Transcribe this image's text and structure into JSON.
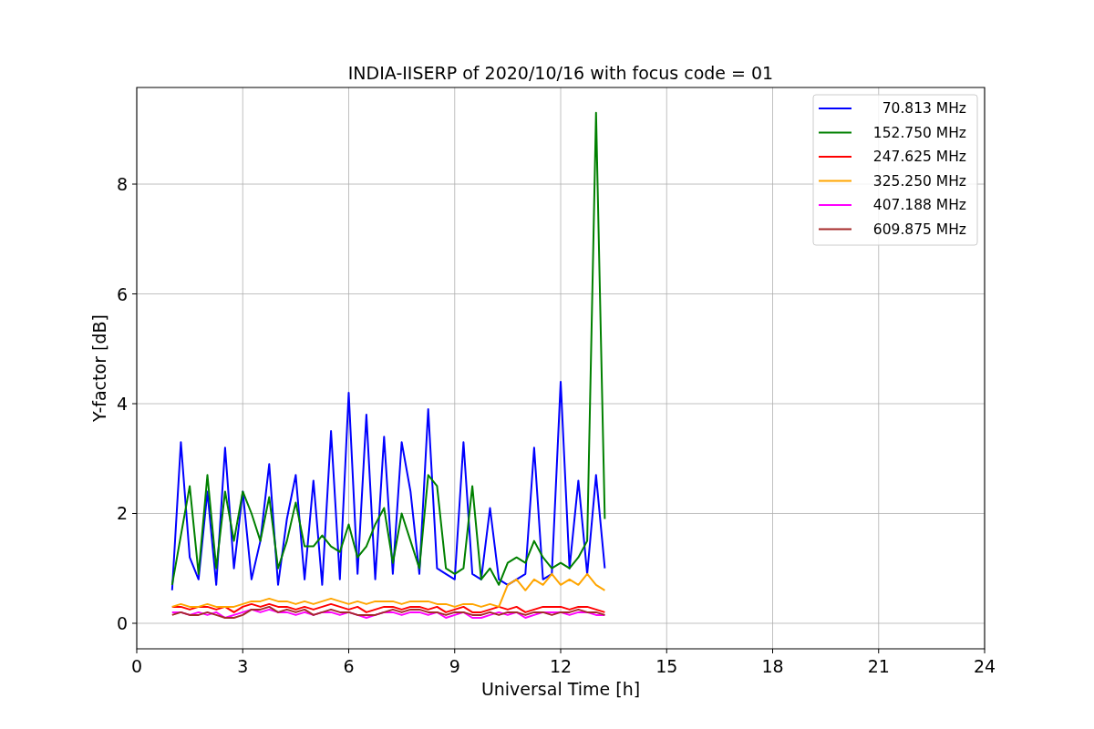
{
  "chart": {
    "chart_data": {
      "type": "line",
      "title": "INDIA-IISERP of 2020/10/16 with focus code = 01",
      "xlabel": "Universal Time [h]",
      "ylabel": "Y-factor [dB]",
      "x": [
        1,
        1.25,
        1.5,
        1.75,
        2,
        2.25,
        2.5,
        2.75,
        3,
        3.25,
        3.5,
        3.75,
        4,
        4.25,
        4.5,
        4.75,
        5,
        5.25,
        5.5,
        5.75,
        6,
        6.25,
        6.5,
        6.75,
        7,
        7.25,
        7.5,
        7.75,
        8,
        8.25,
        8.5,
        8.75,
        9,
        9.25,
        9.5,
        9.75,
        10,
        10.25,
        10.5,
        10.75,
        11,
        11.25,
        11.5,
        11.75,
        12,
        12.25,
        12.5,
        12.75,
        13,
        13.25
      ],
      "series": [
        {
          "name": "70.813 MHz",
          "color": "#0000ff",
          "values": [
            0.6,
            3.3,
            1.2,
            0.8,
            2.4,
            0.7,
            3.2,
            1.0,
            2.4,
            0.8,
            1.5,
            2.9,
            0.7,
            1.9,
            2.7,
            0.8,
            2.6,
            0.7,
            3.5,
            0.8,
            4.2,
            0.9,
            3.8,
            0.8,
            3.4,
            0.9,
            3.3,
            2.4,
            0.9,
            3.9,
            1.0,
            0.9,
            0.8,
            3.3,
            0.9,
            0.8,
            2.1,
            0.8,
            0.7,
            0.8,
            0.9,
            3.2,
            0.8,
            0.9,
            4.4,
            1.0,
            2.6,
            0.9,
            2.7,
            1.0
          ]
        },
        {
          "name": "152.750 MHz",
          "color": "#008000",
          "values": [
            0.7,
            1.6,
            2.5,
            0.9,
            2.7,
            1.0,
            2.4,
            1.5,
            2.4,
            2.0,
            1.5,
            2.3,
            1.0,
            1.5,
            2.2,
            1.4,
            1.4,
            1.6,
            1.4,
            1.3,
            1.8,
            1.2,
            1.4,
            1.8,
            2.1,
            1.1,
            2.0,
            1.5,
            1.0,
            2.7,
            2.5,
            1.0,
            0.9,
            1.0,
            2.5,
            0.8,
            1.0,
            0.7,
            1.1,
            1.2,
            1.1,
            1.5,
            1.2,
            1.0,
            1.1,
            1.0,
            1.2,
            1.5,
            9.3,
            1.9
          ]
        },
        {
          "name": "247.625 MHz",
          "color": "#ff0000",
          "values": [
            0.3,
            0.3,
            0.25,
            0.3,
            0.3,
            0.25,
            0.3,
            0.2,
            0.3,
            0.35,
            0.3,
            0.35,
            0.3,
            0.3,
            0.25,
            0.3,
            0.25,
            0.3,
            0.35,
            0.3,
            0.25,
            0.3,
            0.2,
            0.25,
            0.3,
            0.3,
            0.25,
            0.3,
            0.3,
            0.25,
            0.3,
            0.2,
            0.25,
            0.3,
            0.2,
            0.2,
            0.25,
            0.3,
            0.25,
            0.3,
            0.2,
            0.25,
            0.3,
            0.3,
            0.3,
            0.25,
            0.3,
            0.3,
            0.25,
            0.2
          ]
        },
        {
          "name": "325.250 MHz",
          "color": "#ffa500",
          "values": [
            0.3,
            0.35,
            0.3,
            0.3,
            0.35,
            0.3,
            0.3,
            0.3,
            0.35,
            0.4,
            0.4,
            0.45,
            0.4,
            0.4,
            0.35,
            0.4,
            0.35,
            0.4,
            0.45,
            0.4,
            0.35,
            0.4,
            0.35,
            0.4,
            0.4,
            0.4,
            0.35,
            0.4,
            0.4,
            0.4,
            0.35,
            0.35,
            0.3,
            0.35,
            0.35,
            0.3,
            0.35,
            0.3,
            0.7,
            0.8,
            0.6,
            0.8,
            0.7,
            0.9,
            0.7,
            0.8,
            0.7,
            0.9,
            0.7,
            0.6
          ]
        },
        {
          "name": "407.188 MHz",
          "color": "#ff00ff",
          "values": [
            0.2,
            0.2,
            0.15,
            0.2,
            0.15,
            0.2,
            0.1,
            0.15,
            0.2,
            0.25,
            0.2,
            0.25,
            0.2,
            0.2,
            0.15,
            0.2,
            0.15,
            0.2,
            0.2,
            0.15,
            0.2,
            0.15,
            0.1,
            0.15,
            0.2,
            0.2,
            0.15,
            0.2,
            0.2,
            0.15,
            0.2,
            0.1,
            0.15,
            0.2,
            0.1,
            0.1,
            0.15,
            0.2,
            0.15,
            0.2,
            0.1,
            0.15,
            0.2,
            0.2,
            0.2,
            0.15,
            0.2,
            0.2,
            0.15,
            0.15
          ]
        },
        {
          "name": "609.875 MHz",
          "color": "#a52a2a",
          "values": [
            0.15,
            0.2,
            0.15,
            0.15,
            0.2,
            0.15,
            0.1,
            0.1,
            0.15,
            0.25,
            0.25,
            0.3,
            0.2,
            0.25,
            0.2,
            0.25,
            0.15,
            0.2,
            0.25,
            0.2,
            0.2,
            0.15,
            0.15,
            0.15,
            0.2,
            0.25,
            0.2,
            0.25,
            0.25,
            0.2,
            0.2,
            0.15,
            0.2,
            0.2,
            0.15,
            0.15,
            0.2,
            0.15,
            0.2,
            0.2,
            0.15,
            0.2,
            0.2,
            0.15,
            0.2,
            0.2,
            0.25,
            0.2,
            0.2,
            0.15
          ]
        }
      ],
      "grid": true,
      "legend": "upper right",
      "xlim": [
        0,
        24
      ],
      "ylim": [
        -0.465,
        9.76
      ],
      "xticks": [
        0,
        3,
        6,
        9,
        12,
        15,
        18,
        21,
        24
      ],
      "yticks": [
        0,
        2,
        4,
        6,
        8
      ]
    }
  }
}
